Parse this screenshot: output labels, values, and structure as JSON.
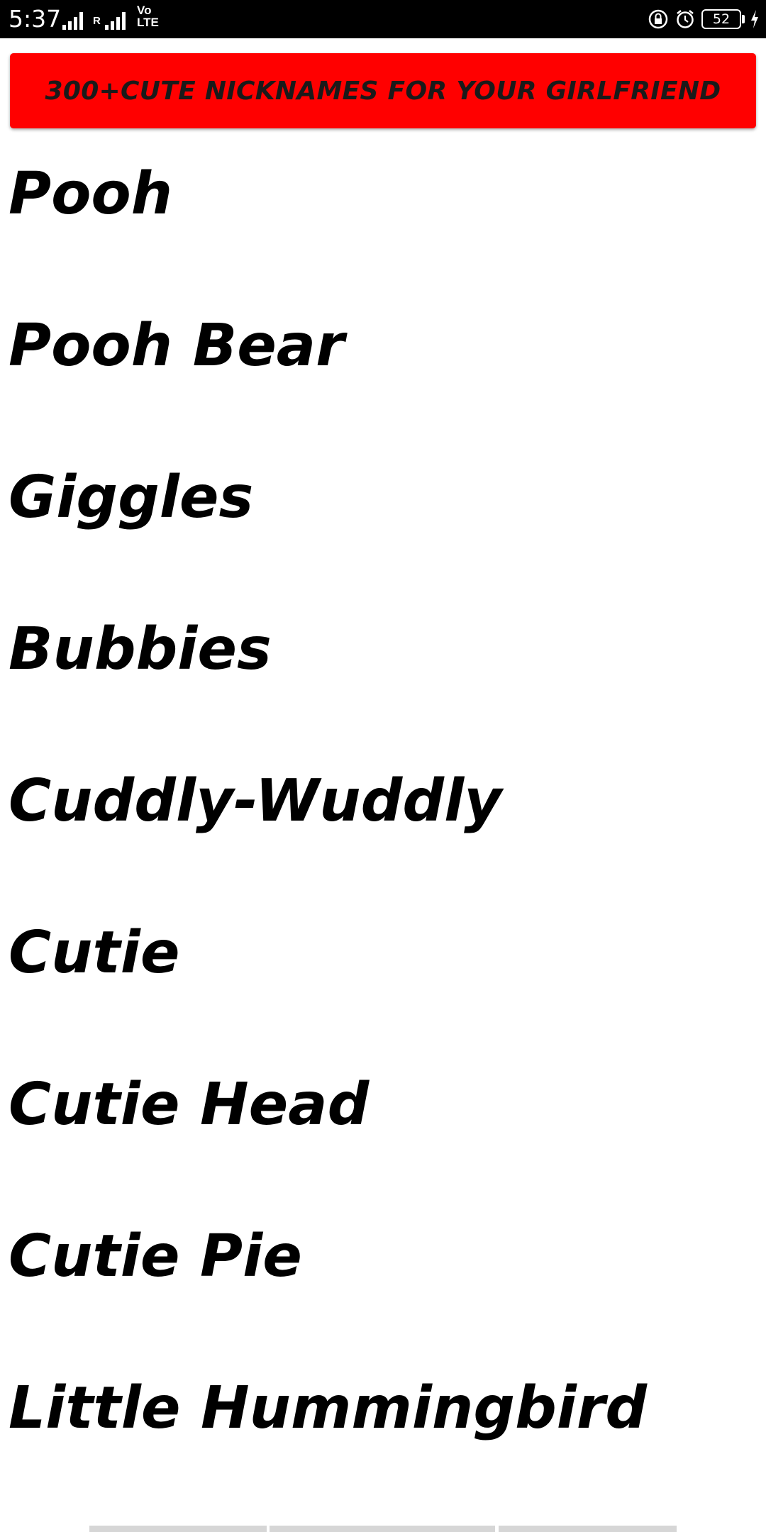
{
  "status_bar": {
    "time": "5:37",
    "roaming": "R",
    "volte_top": "Vo",
    "volte_bottom": "LTE",
    "battery": "52",
    "icons": [
      "signal-icon",
      "signal-icon",
      "lock-rotation-icon",
      "alarm-icon",
      "battery-icon",
      "charging-bolt-icon"
    ]
  },
  "banner": {
    "title": "300+CUTE NICKNAMES FOR YOUR GIRLFRIEND",
    "background": "#ff0000"
  },
  "nicknames": [
    "Pooh",
    "Pooh Bear",
    "Giggles",
    "Bubbies",
    "Cuddly-Wuddly",
    "Cutie",
    "Cutie Head",
    "Cutie Pie",
    "Little Hummingbird"
  ]
}
